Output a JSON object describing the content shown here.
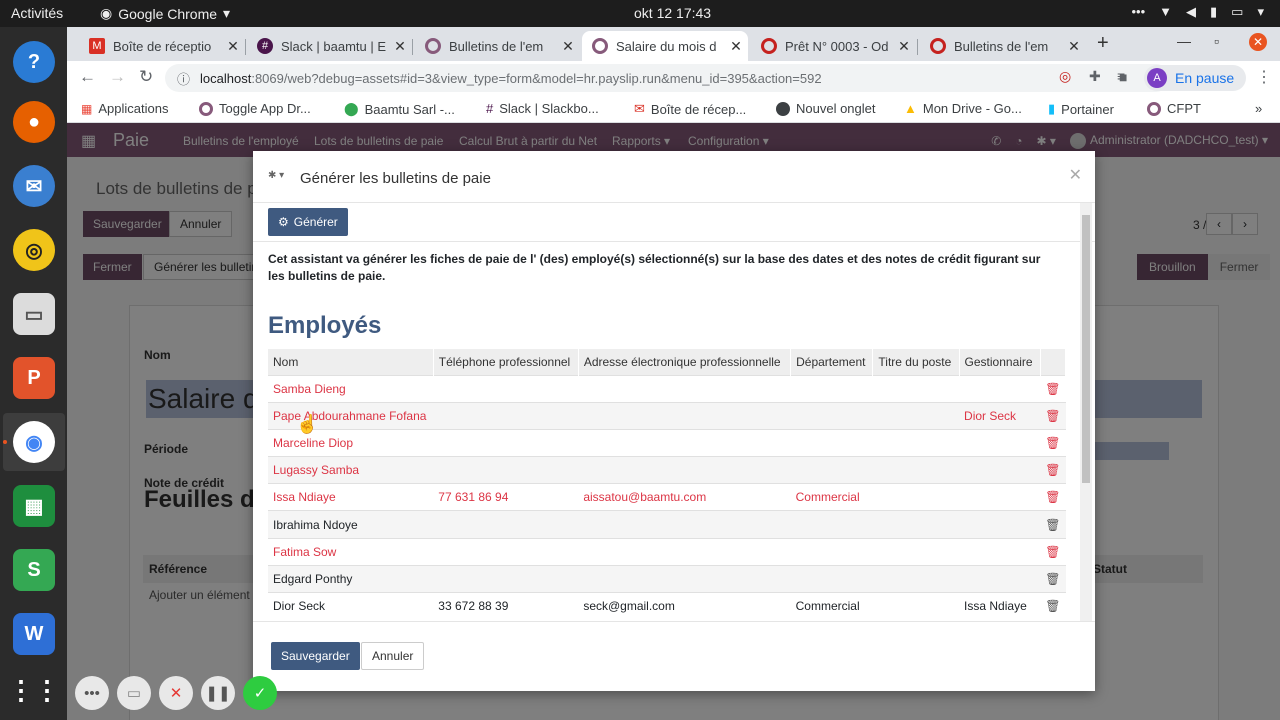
{
  "gnome": {
    "activities": "Activités",
    "app": "Google Chrome",
    "clock": "okt 12  17:43"
  },
  "browser": {
    "tabs": [
      {
        "label": "Boîte de réceptio",
        "icon_color": "#d93025",
        "icon": "gmail-icon"
      },
      {
        "label": "Slack | baamtu | E",
        "icon_color": "#4a154b",
        "icon": "slack-icon"
      },
      {
        "label": "Bulletins de l'em",
        "icon_color": "#875a7b",
        "icon": "odoo-icon"
      },
      {
        "label": "Salaire du mois d",
        "icon_color": "#875a7b",
        "icon": "odoo-icon"
      },
      {
        "label": "Prêt N° 0003 - Od",
        "icon_color": "#c5221f",
        "icon": "odoo-alt-icon"
      },
      {
        "label": "Bulletins de l'em",
        "icon_color": "#c5221f",
        "icon": "odoo-alt-icon"
      }
    ],
    "active_tab": 3,
    "url_host": "localhost",
    "url_path": ":8069/web?debug=assets#id=3&view_type=form&model=hr.payslip.run&menu_id=395&action=592",
    "profile_initial": "A",
    "profile_status": "En pause",
    "bookmarks": [
      {
        "label": "Applications",
        "color": "#ea4335"
      },
      {
        "label": "Toggle App Dr...",
        "color": "#875a7b"
      },
      {
        "label": "Baamtu Sarl -...",
        "color": "#34a853"
      },
      {
        "label": "Slack | Slackbo...",
        "color": "#4a154b"
      },
      {
        "label": "Boîte de récep...",
        "color": "#d93025"
      },
      {
        "label": "Nouvel onglet",
        "color": "#5f6368"
      },
      {
        "label": "Mon Drive - Go...",
        "color": "#fbbc04"
      },
      {
        "label": "Portainer",
        "color": "#13bef9"
      },
      {
        "label": "CFPT",
        "color": "#875a7b"
      }
    ]
  },
  "odoo": {
    "app_name": "Paie",
    "menu": [
      "Bulletins de l'employé",
      "Lots de bulletins de paie",
      "Calcul Brut à partir du Net",
      "Rapports",
      "Configuration"
    ],
    "user": "Administrator (DADCHCO_test)",
    "breadcrumb": "Lots de bulletins de p",
    "save": "Sauvegarder",
    "discard": "Annuler",
    "pager": "3 / 3",
    "close_btn": "Fermer",
    "generate_btn": "Générer les bulletins",
    "status": [
      "Brouillon",
      "Fermer"
    ],
    "bg_fields": {
      "name_label": "Nom",
      "title": "Salaire d",
      "period_label": "Période",
      "credit_label": "Note de crédit",
      "sheets_title": "Feuilles d",
      "ref_header": "Référence",
      "status_header": "Statut",
      "add_line": "Ajouter un élément"
    }
  },
  "modal": {
    "title": "Générer les bulletins de paie",
    "generate": "Générer",
    "description": "Cet assistant va générer les fiches de paie de l' (des) employé(s) sélectionné(s) sur la base des dates et des notes de crédit figurant sur les bulletins de paie.",
    "section": "Employés",
    "columns": [
      "Nom",
      "Téléphone professionnel",
      "Adresse électronique professionnelle",
      "Département",
      "Titre du poste",
      "Gestionnaire"
    ],
    "rows": [
      {
        "name": "Samba Dieng",
        "phone": "",
        "email": "",
        "dept": "",
        "job": "",
        "manager": "",
        "red": true
      },
      {
        "name": "Pape Abdourahmane Fofana",
        "phone": "",
        "email": "",
        "dept": "",
        "job": "",
        "manager": "Dior Seck",
        "red": true
      },
      {
        "name": "Marceline Diop",
        "phone": "",
        "email": "",
        "dept": "",
        "job": "",
        "manager": "",
        "red": true
      },
      {
        "name": "Lugassy Samba",
        "phone": "",
        "email": "",
        "dept": "",
        "job": "",
        "manager": "",
        "red": true
      },
      {
        "name": "Issa Ndiaye",
        "phone": "77 631 86 94",
        "email": "aissatou@baamtu.com",
        "dept": "Commercial",
        "job": "",
        "manager": "",
        "red": true
      },
      {
        "name": "Ibrahima Ndoye",
        "phone": "",
        "email": "",
        "dept": "",
        "job": "",
        "manager": "",
        "red": false
      },
      {
        "name": "Fatima Sow",
        "phone": "",
        "email": "",
        "dept": "",
        "job": "",
        "manager": "",
        "red": true
      },
      {
        "name": "Edgard Ponthy",
        "phone": "",
        "email": "",
        "dept": "",
        "job": "",
        "manager": "",
        "red": false
      },
      {
        "name": "Dior Seck",
        "phone": "33 672 88 39",
        "email": "seck@gmail.com",
        "dept": "Commercial",
        "job": "",
        "manager": "Issa Ndiaye",
        "red": false
      }
    ],
    "save": "Sauvegarder",
    "discard": "Annuler"
  }
}
